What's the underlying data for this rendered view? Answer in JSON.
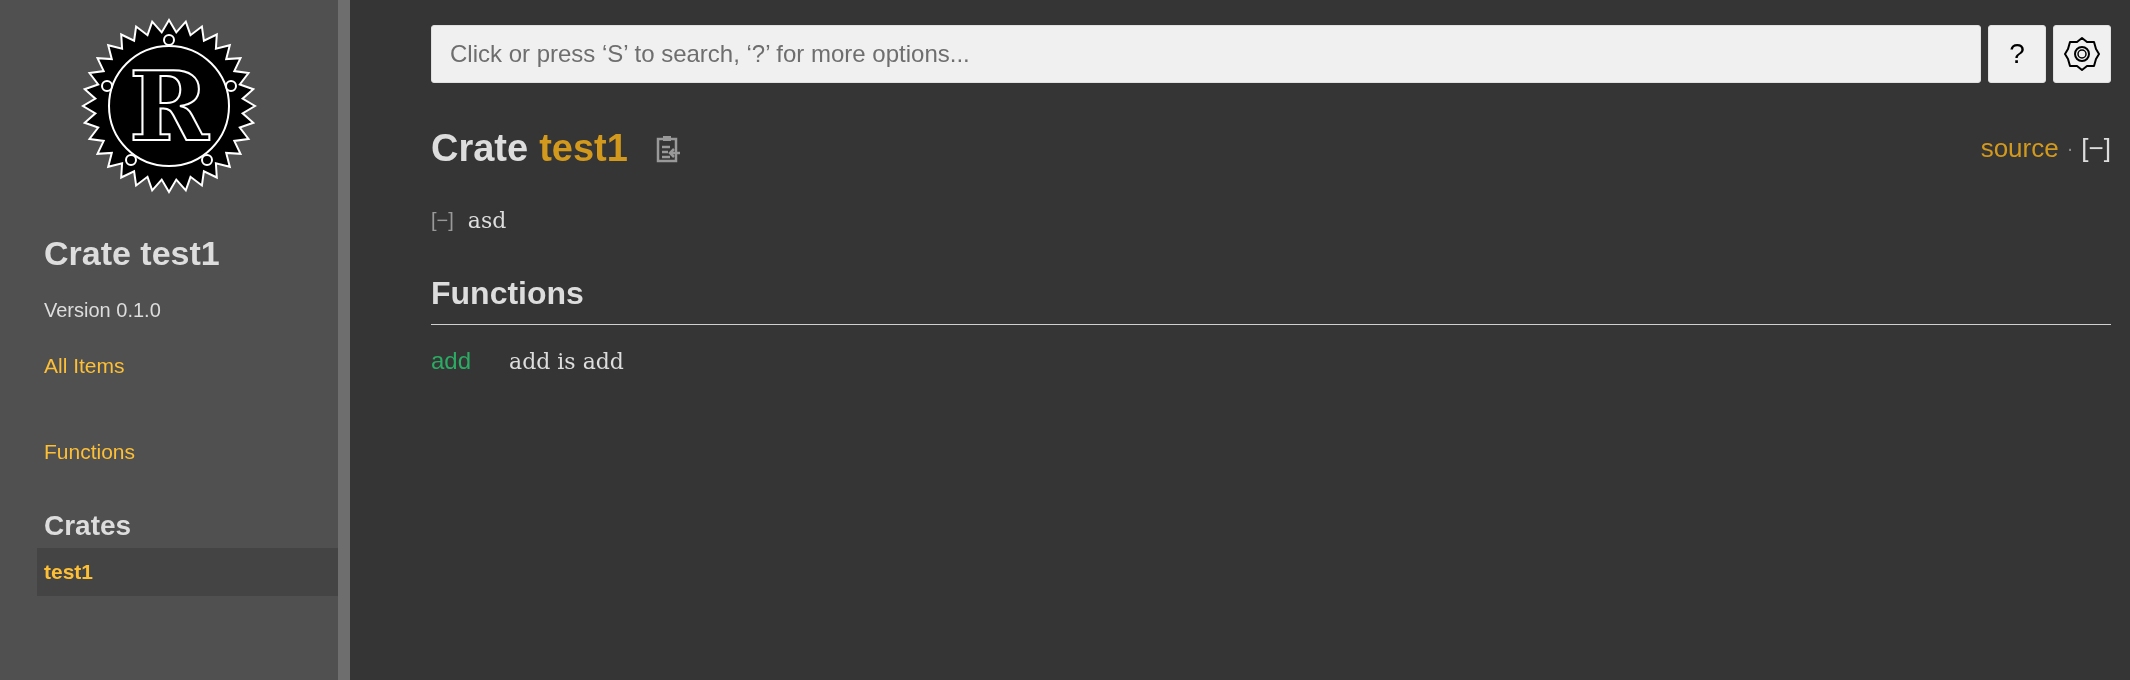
{
  "sidebar": {
    "logo": {
      "letter": "R"
    },
    "title": "Crate test1",
    "version": "Version 0.1.0",
    "links": [
      {
        "label": "All Items"
      },
      {
        "label": "Functions"
      }
    ],
    "crates_heading": "Crates",
    "crates": [
      {
        "label": "test1",
        "selected": true
      }
    ]
  },
  "search": {
    "placeholder": "Click or press ‘S’ to search, ‘?’ for more options...",
    "help_button": "?"
  },
  "main": {
    "title_prefix": "Crate",
    "title_name": "test1",
    "source_link": "source",
    "separator": "·",
    "collapse_toggle": "[−]",
    "doc_toggle": "[−]",
    "doc_text": "asd",
    "section_heading": "Functions",
    "items": [
      {
        "name": "add",
        "description": "add is add"
      }
    ]
  }
}
